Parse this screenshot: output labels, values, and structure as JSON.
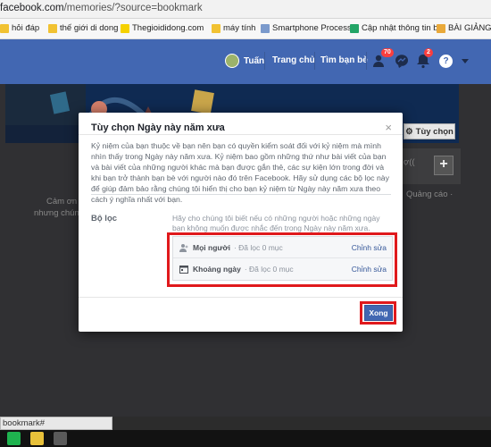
{
  "browser": {
    "url_host": "facebook.com",
    "url_path": "/memories/?source=bookmark",
    "bookmarks": [
      {
        "label": "hỏi đáp",
        "icon": "folder-icon"
      },
      {
        "label": "thế giới di dong",
        "icon": "folder-icon"
      },
      {
        "label": "Thegioididong.com",
        "icon": "tgdd-icon"
      },
      {
        "label": "máy tính",
        "icon": "folder-icon"
      },
      {
        "label": "Smartphone Process",
        "icon": "page-icon"
      },
      {
        "label": "Cập nhật thông tin b",
        "icon": "sheet-icon"
      },
      {
        "label": "BÀI GIẢNG T",
        "icon": "bookmark-icon"
      }
    ],
    "status_text": "bookmark#"
  },
  "fb_topbar": {
    "user_name": "Tuấn",
    "nav": [
      "Trang chủ",
      "Tìm bạn bè"
    ],
    "friend_requests_count": "70",
    "notifications_count": "2",
    "help_label": "?"
  },
  "page_background": {
    "side_button_label": "Tùy chọn",
    "fragments": [
      "Cảm ơn b",
      "nhưng chúng",
      "Quảng cáo ·",
      "ợ(("
    ]
  },
  "modal": {
    "title": "Tùy chọn Ngày này năm xưa",
    "close_label": "×",
    "description": "Kỷ niệm của bạn thuộc về bạn nên bạn có quyền kiểm soát đối với kỷ niệm mà mình nhìn thấy trong Ngày này năm xưa. Kỷ niệm bao gồm những thứ như bài viết của bạn và bài viết của những người khác mà bạn được gắn thẻ, các sự kiện lớn trong đời và khi bạn trở thành bạn bè với người nào đó trên Facebook. Hãy sử dụng các bộ lọc này để giúp đảm bảo rằng chúng tôi hiển thị cho bạn kỷ niệm từ Ngày này năm xưa theo cách ý nghĩa nhất với bạn.",
    "filter_label": "Bộ lọc",
    "filter_description": "Hãy cho chúng tôi biết nếu có những người hoặc những ngày bạn không muốn được nhắc đến trong Ngày này năm xưa.",
    "filters": [
      {
        "name": "Mọi người",
        "status": "· Đã lọc 0 mục",
        "edit": "Chỉnh sửa",
        "icon": "people-icon"
      },
      {
        "name": "Khoảng ngày",
        "status": "· Đã lọc 0 mục",
        "edit": "Chỉnh sửa",
        "icon": "calendar-icon"
      }
    ],
    "done_label": "Xong"
  },
  "colors": {
    "fb_blue": "#4267b2",
    "highlight_red": "#e0191c",
    "link_blue": "#365899"
  }
}
